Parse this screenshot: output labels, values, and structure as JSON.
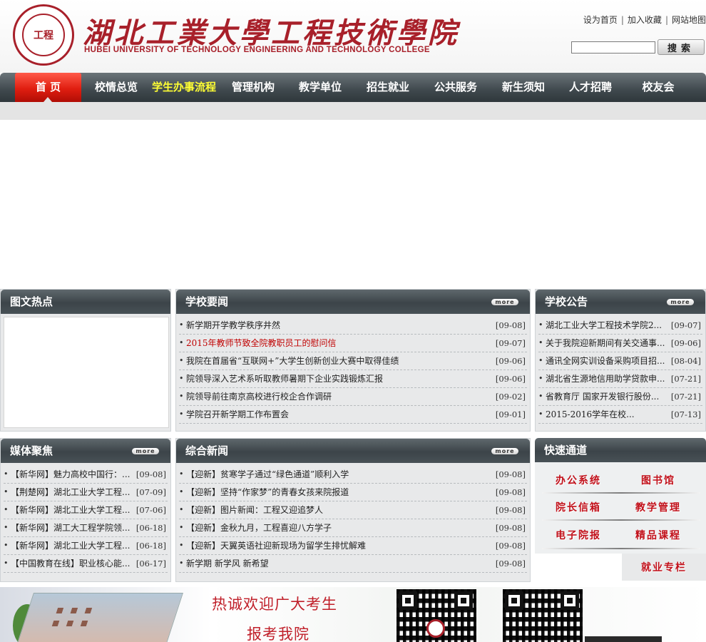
{
  "header": {
    "logo_title": "湖北工業大學工程技術學院",
    "logo_subtitle": "HUBEI UNIVERSITY OF TECHNOLOGY ENGINEERING AND TECHNOLOGY COLLEGE",
    "logo_seal_text": "工程",
    "links": [
      "设为首页",
      "加入收藏",
      "网站地图"
    ],
    "search_placeholder": "",
    "search_button": "搜索"
  },
  "nav": {
    "items": [
      "首 页",
      "校情总览",
      "学生办事流程",
      "管理机构",
      "教学单位",
      "招生就业",
      "公共服务",
      "新生须知",
      "人才招聘",
      "校友会"
    ],
    "active_index": 0,
    "highlight_index": 2
  },
  "panels": {
    "photo_hot": {
      "title": "图文热点"
    },
    "school_news": {
      "title": "学校要闻",
      "more": "more",
      "items": [
        {
          "title": "新学期开学教学秩序井然",
          "date": "[09-08]",
          "red": false
        },
        {
          "title": "2015年教师节致全院教职员工的慰问信",
          "date": "[09-07]",
          "red": true
        },
        {
          "title": "我院在首届省“互联网+”大学生创新创业大赛中取得佳绩",
          "date": "[09-06]",
          "red": false
        },
        {
          "title": "院领导深入艺术系听取教师暑期下企业实践锻炼汇报",
          "date": "[09-06]",
          "red": false
        },
        {
          "title": "院领导前往南京高校进行校企合作调研",
          "date": "[09-02]",
          "red": false
        },
        {
          "title": "学院召开新学期工作布置会",
          "date": "[09-01]",
          "red": false
        }
      ]
    },
    "announcements": {
      "title": "学校公告",
      "more": "more",
      "items": [
        {
          "title": "湖北工业大学工程技术学院2...",
          "date": "[09-07]"
        },
        {
          "title": "关于我院迎新期间有关交通事...",
          "date": "[09-06]"
        },
        {
          "title": "通讯全网实训设备采购项目招...",
          "date": "[08-04]"
        },
        {
          "title": "湖北省生源地信用助学贷款申...",
          "date": "[07-21]"
        },
        {
          "title": "省教育厅 国家开发银行股份...",
          "date": "[07-21]"
        },
        {
          "title": "2015-2016学年在校...",
          "date": "[07-13]"
        }
      ]
    },
    "media": {
      "title": "媒体聚焦",
      "more": "more",
      "items": [
        {
          "title": "【新华网】魅力高校中国行：...",
          "date": "[09-08]"
        },
        {
          "title": "【荆楚网】湖北工业大学工程...",
          "date": "[07-09]"
        },
        {
          "title": "【新华网】湖北工业大学工程...",
          "date": "[07-06]"
        },
        {
          "title": "【新华网】湖工大工程学院领...",
          "date": "[06-18]"
        },
        {
          "title": "【新华网】湖北工业大学工程...",
          "date": "[06-18]"
        },
        {
          "title": "【中国教育在线】职业核心能...",
          "date": "[06-17]"
        }
      ]
    },
    "general_news": {
      "title": "综合新闻",
      "more": "more",
      "items": [
        {
          "title": "【迎新】贫寒学子通过“绿色通道”顺利入学",
          "date": "[09-08]"
        },
        {
          "title": "【迎新】坚持“作家梦”的青春女孩来院报道",
          "date": "[09-08]"
        },
        {
          "title": "【迎新】图片新闻：工程又迎追梦人",
          "date": "[09-08]"
        },
        {
          "title": "【迎新】金秋九月，工程喜迎八方学子",
          "date": "[09-08]"
        },
        {
          "title": "【迎新】天翼英语社迎新现场为留学生排忧解难",
          "date": "[09-08]"
        },
        {
          "title": "新学期 新学风 新希望",
          "date": "[09-08]"
        }
      ]
    },
    "quick": {
      "title": "快速通道",
      "links": [
        "办公系统",
        "图书馆",
        "院长信箱",
        "教学管理",
        "电子院报",
        "精品课程",
        "就业专栏"
      ]
    }
  },
  "banner": {
    "line1": "热诚欢迎广大考生",
    "line2": "报考我院"
  },
  "colors": {
    "brand_red": "#a8202a",
    "nav_dark": "#3f484d",
    "nav_active": "#e01e10",
    "nav_highlight": "#ffff33"
  }
}
